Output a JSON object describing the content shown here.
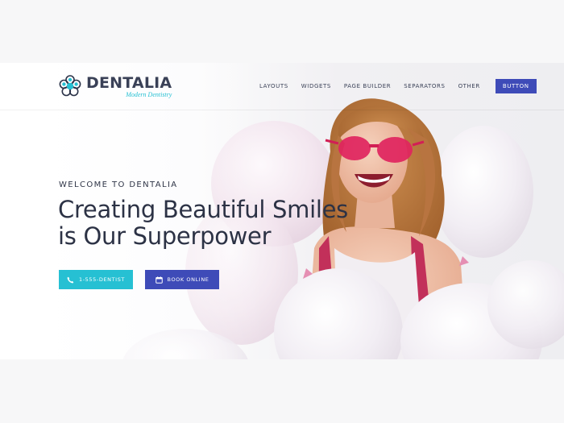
{
  "brand": {
    "name": "DENTALIA",
    "tagline": "Modern Dentistry",
    "accent_color": "#26c0d3",
    "primary_color": "#3e4bb8"
  },
  "nav": {
    "items": [
      "LAYOUTS",
      "WIDGETS",
      "PAGE BUILDER",
      "SEPARATORS",
      "OTHER"
    ],
    "button_label": "BUTTON"
  },
  "hero": {
    "eyebrow": "WELCOME TO DENTALIA",
    "headline_line1": "Creating Beautiful Smiles",
    "headline_line2": "is Our Superpower",
    "phone_button": {
      "label": "1-555-DENTIST",
      "icon": "phone-icon"
    },
    "book_button": {
      "label": "BOOK ONLINE",
      "icon": "calendar-icon"
    }
  }
}
